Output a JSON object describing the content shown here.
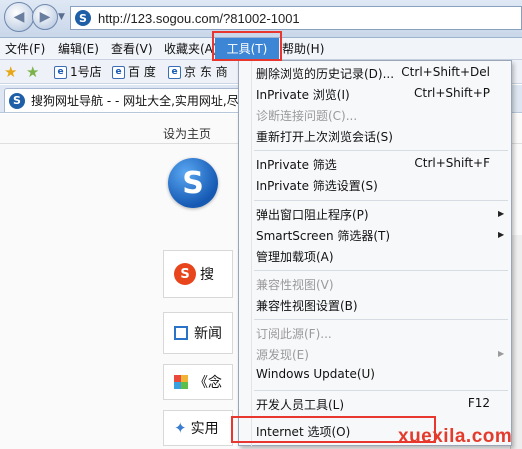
{
  "browser": {
    "url": "http://123.sogou.com/?81002-1001",
    "address_icon": "sogou-icon",
    "nav": {
      "back_icon": "back-arrow-icon",
      "forward_icon": "forward-arrow-icon"
    }
  },
  "menubar": {
    "items": [
      {
        "label": "文件(F)"
      },
      {
        "label": "编辑(E)"
      },
      {
        "label": "查看(V)"
      },
      {
        "label": "收藏夹(A)"
      },
      {
        "label": "工具(T)"
      },
      {
        "label": "帮助(H)"
      }
    ],
    "active_index": 4,
    "highlight_color": "#e8372f",
    "active_bg": "#3d86d6"
  },
  "favorites": {
    "items": [
      {
        "label": "1号店"
      },
      {
        "label": "百 度"
      },
      {
        "label": "京 东 商"
      }
    ]
  },
  "tab": {
    "title": "搜狗网址导航 - - 网址大全,实用网址,尽"
  },
  "page": {
    "set_home": "设为主页",
    "cards": [
      {
        "label": "搜"
      },
      {
        "label": "新闻"
      },
      {
        "label": "《念"
      },
      {
        "label": "实用"
      }
    ]
  },
  "tools_menu": {
    "items": [
      {
        "label": "删除浏览的历史记录(D)...",
        "shortcut": "Ctrl+Shift+Del",
        "disabled": false
      },
      {
        "label": "InPrivate 浏览(I)",
        "shortcut": "Ctrl+Shift+P",
        "disabled": false
      },
      {
        "label": "诊断连接问题(C)...",
        "shortcut": "",
        "disabled": true
      },
      {
        "label": "重新打开上次浏览会话(S)",
        "shortcut": "",
        "disabled": false
      },
      {
        "label": "InPrivate 筛选",
        "shortcut": "Ctrl+Shift+F",
        "disabled": false
      },
      {
        "label": "InPrivate 筛选设置(S)",
        "shortcut": "",
        "disabled": false
      },
      {
        "label": "弹出窗口阻止程序(P)",
        "shortcut": "",
        "disabled": false,
        "submenu": true
      },
      {
        "label": "SmartScreen 筛选器(T)",
        "shortcut": "",
        "disabled": false,
        "submenu": true
      },
      {
        "label": "管理加载项(A)",
        "shortcut": "",
        "disabled": false
      },
      {
        "label": "兼容性视图(V)",
        "shortcut": "",
        "disabled": true
      },
      {
        "label": "兼容性视图设置(B)",
        "shortcut": "",
        "disabled": false
      },
      {
        "label": "订阅此源(F)...",
        "shortcut": "",
        "disabled": true
      },
      {
        "label": "源发现(E)",
        "shortcut": "",
        "disabled": true,
        "submenu": true
      },
      {
        "label": "Windows Update(U)",
        "shortcut": "",
        "disabled": false
      },
      {
        "label": "开发人员工具(L)",
        "shortcut": "F12",
        "disabled": false
      },
      {
        "label": "Internet 选项(O)",
        "shortcut": "",
        "disabled": false
      }
    ],
    "highlighted_item": "Internet 选项(O)"
  },
  "watermark": "xuexila.com"
}
